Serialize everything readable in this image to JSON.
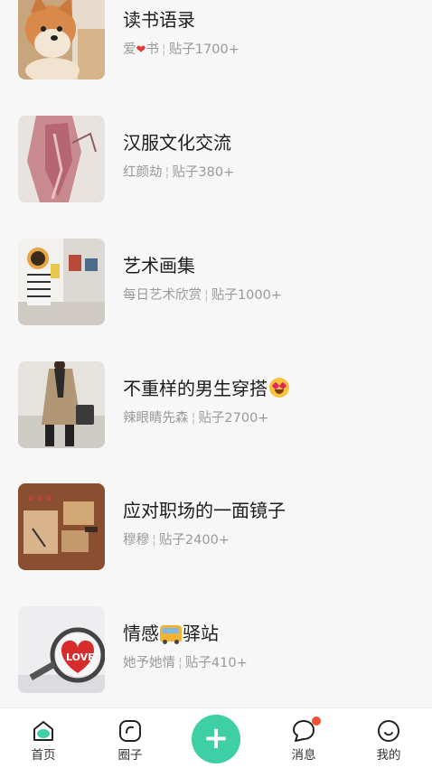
{
  "groups": [
    {
      "title": "读书语录",
      "owner": "爱",
      "owner_suffix": "书",
      "posts": "贴子1700+"
    },
    {
      "title": "汉服文化交流",
      "owner": "红颜劫",
      "posts": "贴子380+"
    },
    {
      "title": "艺术画集",
      "owner": "每日艺术欣赏",
      "posts": "贴子1000+"
    },
    {
      "title": "不重样的男生穿搭",
      "owner": "辣眼睛先森",
      "posts": "贴子2700+"
    },
    {
      "title": "应对职场的一面镜子",
      "owner": "穆穆",
      "posts": "贴子2400+"
    },
    {
      "title": "情感",
      "title_suffix": "驿站",
      "owner": "她予她情",
      "posts": "贴子410+"
    }
  ],
  "separator": "¦",
  "emoji": {
    "heart": "❤",
    "face": "star-struck-emoji",
    "bus": "bus-emoji"
  },
  "tabbar": {
    "home": "首页",
    "circle": "圈子",
    "add": "+",
    "messages": "消息",
    "mine": "我的"
  },
  "colors": {
    "accent": "#3fcfa4",
    "badge": "#f2502e",
    "title": "#1d1d1d",
    "meta": "#9a9a9a"
  }
}
